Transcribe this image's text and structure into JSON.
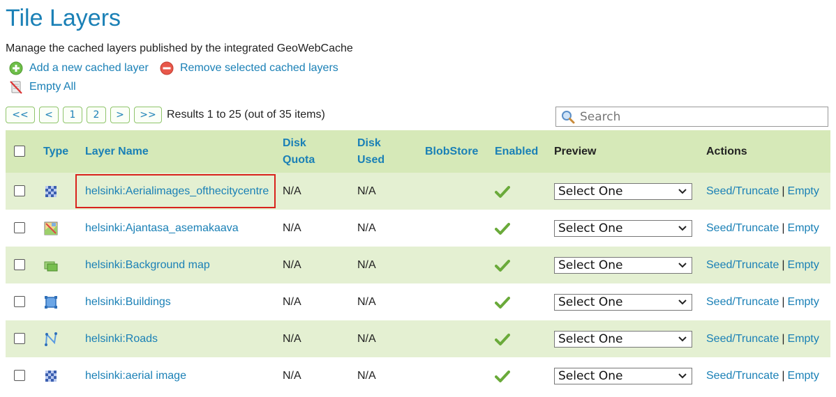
{
  "page": {
    "title": "Tile Layers",
    "description": "Manage the cached layers published by the integrated GeoWebCache"
  },
  "actions": {
    "add_label": "Add a new cached layer",
    "remove_label": "Remove selected cached layers",
    "empty_all_label": "Empty All"
  },
  "pager": {
    "first": "<<",
    "prev": "<",
    "page1": "1",
    "page2": "2",
    "next": ">",
    "last": ">>",
    "results": "Results 1 to 25 (out of 35 items)"
  },
  "search": {
    "placeholder": "Search",
    "value": ""
  },
  "table": {
    "headers": {
      "type": "Type",
      "layer_name": "Layer Name",
      "disk_quota_line1": "Disk",
      "disk_quota_line2": "Quota",
      "disk_used_line1": "Disk",
      "disk_used_line2": "Used",
      "blobstore": "BlobStore",
      "enabled": "Enabled",
      "preview": "Preview",
      "actions": "Actions"
    },
    "rows": [
      {
        "type_icon": "raster-icon",
        "name": "helsinki:Aerialimages_ofthecitycentre",
        "disk_quota": "N/A",
        "disk_used": "N/A",
        "blobstore": "",
        "preview": "Select One",
        "seed": "Seed/Truncate",
        "sep": "|",
        "empty": "Empty"
      },
      {
        "type_icon": "map-layer-icon",
        "name": "helsinki:Ajantasa_asemakaava",
        "disk_quota": "N/A",
        "disk_used": "N/A",
        "blobstore": "",
        "preview": "Select One",
        "seed": "Seed/Truncate",
        "sep": "|",
        "empty": "Empty"
      },
      {
        "type_icon": "layer-group-icon",
        "name": "helsinki:Background map",
        "disk_quota": "N/A",
        "disk_used": "N/A",
        "blobstore": "",
        "preview": "Select One",
        "seed": "Seed/Truncate",
        "sep": "|",
        "empty": "Empty"
      },
      {
        "type_icon": "polygon-icon",
        "name": "helsinki:Buildings",
        "disk_quota": "N/A",
        "disk_used": "N/A",
        "blobstore": "",
        "preview": "Select One",
        "seed": "Seed/Truncate",
        "sep": "|",
        "empty": "Empty"
      },
      {
        "type_icon": "line-icon",
        "name": "helsinki:Roads",
        "disk_quota": "N/A",
        "disk_used": "N/A",
        "blobstore": "",
        "preview": "Select One",
        "seed": "Seed/Truncate",
        "sep": "|",
        "empty": "Empty"
      },
      {
        "type_icon": "raster-icon",
        "name": "helsinki:aerial image",
        "disk_quota": "N/A",
        "disk_used": "N/A",
        "blobstore": "",
        "preview": "Select One",
        "seed": "Seed/Truncate",
        "sep": "|",
        "empty": "Empty"
      }
    ]
  },
  "colors": {
    "link": "#1a80b6",
    "header_bg": "#d6e9b8",
    "odd_row_bg": "#e4f0d2",
    "highlight_box": "#d9221c",
    "enabled_check": "#6aaa3a"
  }
}
